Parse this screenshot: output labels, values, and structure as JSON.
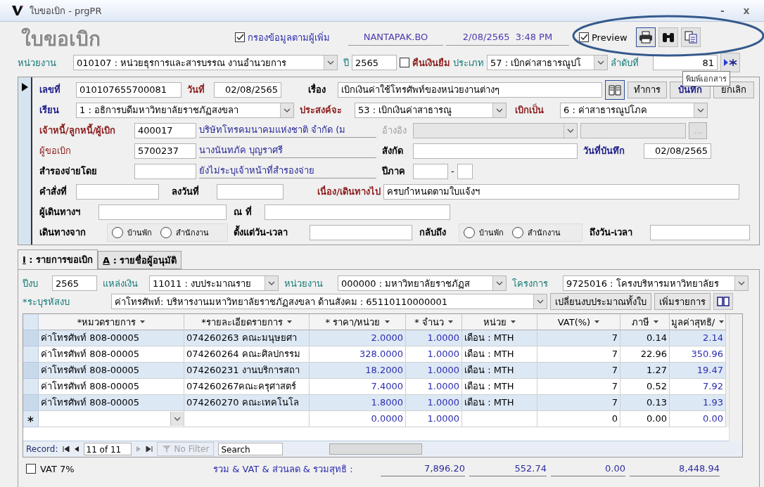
{
  "window": {
    "title": "ใบขอเบิก - prgPR",
    "minimize": "-",
    "close": "x"
  },
  "header": {
    "title": "ใบขอเบิก",
    "filter": {
      "label": "กรองข้อมูลตามผู้เพิ่ม",
      "checked": true
    },
    "user": "NANTAPAK.BO",
    "datetime": "2/08/2565  3:48 PM",
    "preview": {
      "label": "Preview",
      "checked": true
    },
    "tooltip": "พิมพ์เอกสาร"
  },
  "toolbar": {
    "unit_label": "หน่วยงาน",
    "unit": "010107 : หน่วยธุรการและสารบรรณ งานอำนวยการ",
    "year_label": "ปี",
    "year": "2565",
    "refund": {
      "label": "คืนเงินยืม",
      "checked": false
    },
    "type_label": "ประเภท",
    "type": "57 : เบิกค่าสาธารณูปโ",
    "seq_label": "ลำดับที่",
    "seq": "81"
  },
  "form": {
    "doc_no_label": "เลขที่",
    "doc_no": "010107655700081",
    "date_label": "วันที่",
    "date": "02/08/2565",
    "subject_label": "เรื่อง",
    "subject": "เบิกเงินค่าใช้โทรศัพท์ของหน่วยงานต่างๆ",
    "buttons": [
      "ทำการ",
      "บันทึก",
      "ยกเลิก"
    ],
    "to_label": "เรียน",
    "to": "1 : อธิการบดีมหาวิทยาลัยราชภัฏสงขลา",
    "purpose_label": "ประสงค์จะ",
    "purpose": "53 : เบิกเงินค่าสาธารณู",
    "pay_as_label": "เบิกเป็น",
    "pay_as": "6 : ค่าสาธารณูปโภค",
    "creditor_label": "เจ้าหนี้/ลูกหนี้/ผู้เบิก",
    "creditor_code": "400017",
    "creditor_name": "บริษัทโทรคมนาคมแห่งชาติ จำกัด (ม",
    "ref_label": "อ้างอิง",
    "ref_disabled": true,
    "ref_button": "...",
    "requester_label": "ผู้ขอเบิก",
    "requester_code": "5700237",
    "requester_name": "นางนันทภัค บุญราศรี",
    "affil_label": "สังกัด",
    "record_date_label": "วันที่บันทึก",
    "record_date": "02/08/2565",
    "advance_label": "สำรองจ่ายโดย",
    "advance_name": "ยังไม่ระบุเจ้าหน้าที่สำรองจ่าย",
    "period_label": "ปีภาค",
    "period_sep": "-",
    "order_label": "คำสั่งที่",
    "signed_label": "ลงวันที่",
    "reason_label": "เนื่อง/เดินทางไป",
    "reason": "ครบกำหนดตามใบแจ้งฯ",
    "traveler_label": "ผู้เดินทางฯ",
    "at_label": "ณ ที่",
    "from_label": "เดินทางจาก",
    "from_options": [
      {
        "label": "บ้านพัก",
        "selected": false
      },
      {
        "label": "สำนักงาน",
        "selected": false
      }
    ],
    "start_label": "ตั้งแต่วัน-เวลา",
    "return_label": "กลับถึง",
    "return_options": [
      {
        "label": "บ้านพัก",
        "selected": false
      },
      {
        "label": "สำนักงาน",
        "selected": false
      }
    ],
    "end_label": "ถึงวัน-เวลา"
  },
  "tabs": [
    {
      "key": "I",
      "label": " : รายการขอเบิก",
      "selected": true
    },
    {
      "key": "A",
      "label": " : รายชื่อผู้อนุมัติ",
      "selected": false
    }
  ],
  "filters": {
    "budget_year_label": "ปีงบ",
    "budget_year": "2565",
    "source_label": "แหล่งเงิน",
    "source": "11011 : งบประมาณราย",
    "unit_label": "หน่วยงาน",
    "unit": "000000 : มหาวิทยาลัยราชภัฏส",
    "project_label": "โครงการ",
    "project": "9725016 : โครงบริหารมหาวิทยาลัยร",
    "code_label": "*ระบุรหัสงบ",
    "code": "ค่าโทรศัพท์: บริหารงานมหาวิทยาลัยราชภัฏสงขลา ด้านสังคม : 65110110000001",
    "buttons": [
      "เปลี่ยนงบประมาณทั้งใบ",
      "เพิ่มรายการ"
    ]
  },
  "table": {
    "columns": [
      "*หมวดรายการ",
      "*รายละเอียดรายการ",
      "* ราคา/หน่วย",
      "* จำนว",
      "หน่วย",
      "VAT(%)",
      "ภาษี",
      "มูลค่าสุทธิ/"
    ],
    "rows": [
      [
        "ค่าโทรศัพท์ 808-00005",
        "074260263 คณะมนุษยศา",
        "2.0000",
        "1.0000",
        "เดือน : MTH",
        "7",
        "0.14",
        "2.14"
      ],
      [
        "ค่าโทรศัพท์ 808-00005",
        "074260264 คณะศิลปกรรม",
        "328.0000",
        "1.0000",
        "เดือน : MTH",
        "7",
        "22.96",
        "350.96"
      ],
      [
        "ค่าโทรศัพท์ 808-00005",
        "074260231 งานบริการสถา",
        "18.2000",
        "1.0000",
        "เดือน : MTH",
        "7",
        "1.27",
        "19.47"
      ],
      [
        "ค่าโทรศัพท์ 808-00005",
        "074260267คณะครุศาสตร์",
        "7.4000",
        "1.0000",
        "เดือน : MTH",
        "7",
        "0.52",
        "7.92"
      ],
      [
        "ค่าโทรศัพท์ 808-00005",
        "074260270 คณะเทคโนโล",
        "1.8000",
        "1.0000",
        "เดือน : MTH",
        "7",
        "0.13",
        "1.93"
      ]
    ],
    "new_row_marker": "∗",
    "new_row": {
      "price": "0.0000",
      "qty": "1.0000",
      "vat": "0",
      "tax": "0.00",
      "net": "0.00"
    }
  },
  "record_nav": {
    "label": "Record:",
    "position": "11 of 11",
    "filter": "No Filter",
    "search": "Search"
  },
  "footer": {
    "vat": {
      "label": "VAT 7%",
      "checked": false
    },
    "totals_label": "รวม & VAT & ส่วนลด & รวมสุทธิ :",
    "totals": [
      "7,896.20",
      "552.74",
      "0.00",
      "8,448.94"
    ]
  }
}
